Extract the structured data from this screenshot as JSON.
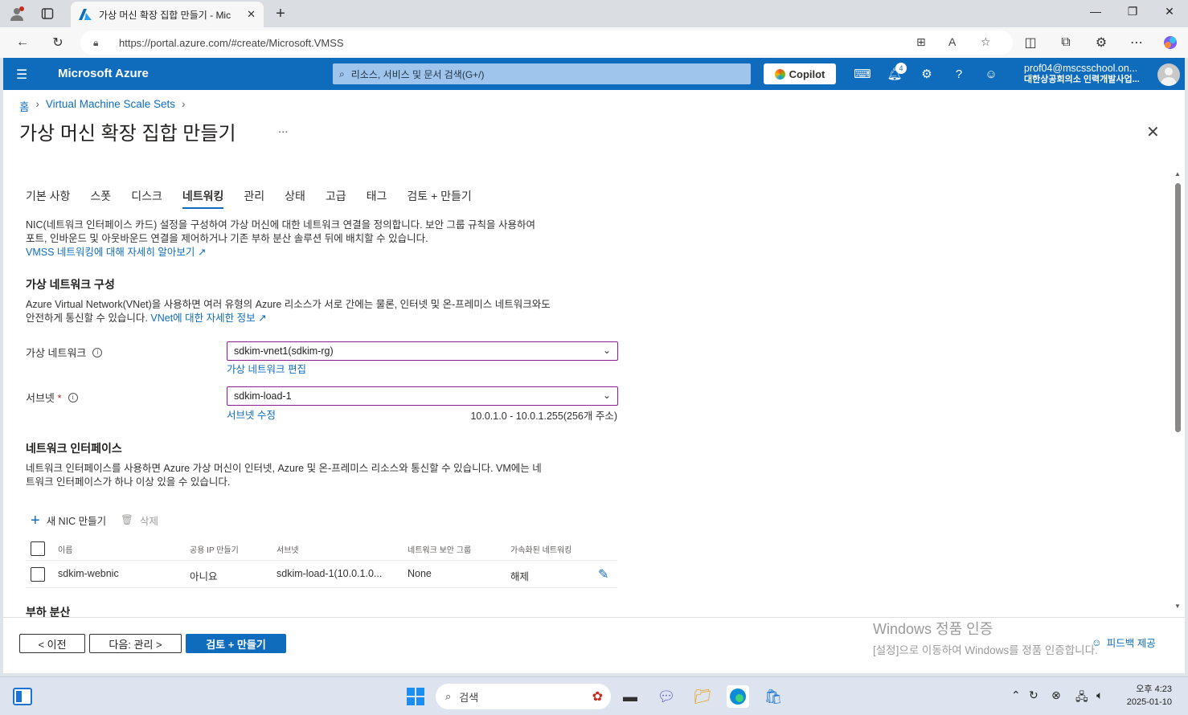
{
  "browser": {
    "tab_title": "가상 머신 확장 집합 만들기 - Mic",
    "url": "https://portal.azure.com/#create/Microsoft.VMSS"
  },
  "azure_header": {
    "brand": "Microsoft Azure",
    "search_placeholder": "리소스, 서비스 및 문서 검색(G+/)",
    "copilot_label": "Copilot",
    "notification_count": "4",
    "account_email": "prof04@mscsschool.on...",
    "account_org": "대한상공회의소 인력개발사업..."
  },
  "breadcrumb": {
    "home": "홈",
    "item1": "Virtual Machine Scale Sets"
  },
  "page": {
    "title": "가상 머신 확장 집합 만들기",
    "more": "..."
  },
  "tabs": [
    "기본 사항",
    "스폿",
    "디스크",
    "네트워킹",
    "관리",
    "상태",
    "고급",
    "태그",
    "검토 + 만들기"
  ],
  "active_tab": "네트워킹",
  "intro": {
    "line1": "NIC(네트워크 인터페이스 카드) 설정을 구성하여 가상 머신에 대한 네트워크 연결을 정의합니다. 보안 그룹 규칙을 사용하여",
    "line2": "포트, 인바운드 및 아웃바운드 연결을 제어하거나 기존 부하 분산 솔루션 뒤에 배치할 수 있습니다.",
    "link": "VMSS 네트워킹에 대해 자세히 알아보기"
  },
  "vnet_section": {
    "heading": "가상 네트워크 구성",
    "line1": "Azure Virtual Network(VNet)을 사용하면 여러 유형의 Azure 리소스가 서로 간에는 물론, 인터넷 및 온-프레미스 네트워크와도",
    "line2_text": "안전하게 통신할 수 있습니다.",
    "line2_link": "VNet에 대한 자세한 정보",
    "vnet_label": "가상 네트워크",
    "vnet_value": "sdkim-vnet1(sdkim-rg)",
    "vnet_edit": "가상 네트워크 편집",
    "subnet_label": "서브넷",
    "subnet_required": "*",
    "subnet_value": "sdkim-load-1",
    "subnet_edit": "서브넷 수정",
    "subnet_range": "10.0.1.0 - 10.0.1.255(256개 주소)"
  },
  "nic_section": {
    "heading": "네트워크 인터페이스",
    "line1": "네트워크 인터페이스를 사용하면 Azure 가상 머신이 인터넷, Azure 및 온-프레미스 리소스와 통신할 수 있습니다. VM에는 네",
    "line2": "트워크 인터페이스가 하나 이상 있을 수 있습니다.",
    "add_label": "새 NIC 만들기",
    "delete_label": "삭제",
    "columns": [
      "이름",
      "공용 IP 만들기",
      "서브넷",
      "네트워크 보안 그룹",
      "가속화된 네트워킹"
    ],
    "rows": [
      {
        "name": "sdkim-webnic",
        "public_ip": "아니요",
        "subnet": "sdkim-load-1(10.0.1.0...",
        "nsg": "None",
        "accel": "해제"
      }
    ]
  },
  "next_section_heading": "부하 분산",
  "footer": {
    "prev": "< 이전",
    "next": "다음: 관리 >",
    "review": "검토 + 만들기",
    "watermark_title": "Windows 정품 인증",
    "watermark_sub": "[설정]으로 이동하여 Windows를 정품 인증합니다.",
    "feedback": "피드백 제공"
  },
  "taskbar": {
    "search": "검색",
    "time": "오후 4:23",
    "date": "2025-01-10"
  },
  "colors": {
    "azure_blue": "#0f6cbd",
    "dropdown_border": "#8a1d8f"
  }
}
